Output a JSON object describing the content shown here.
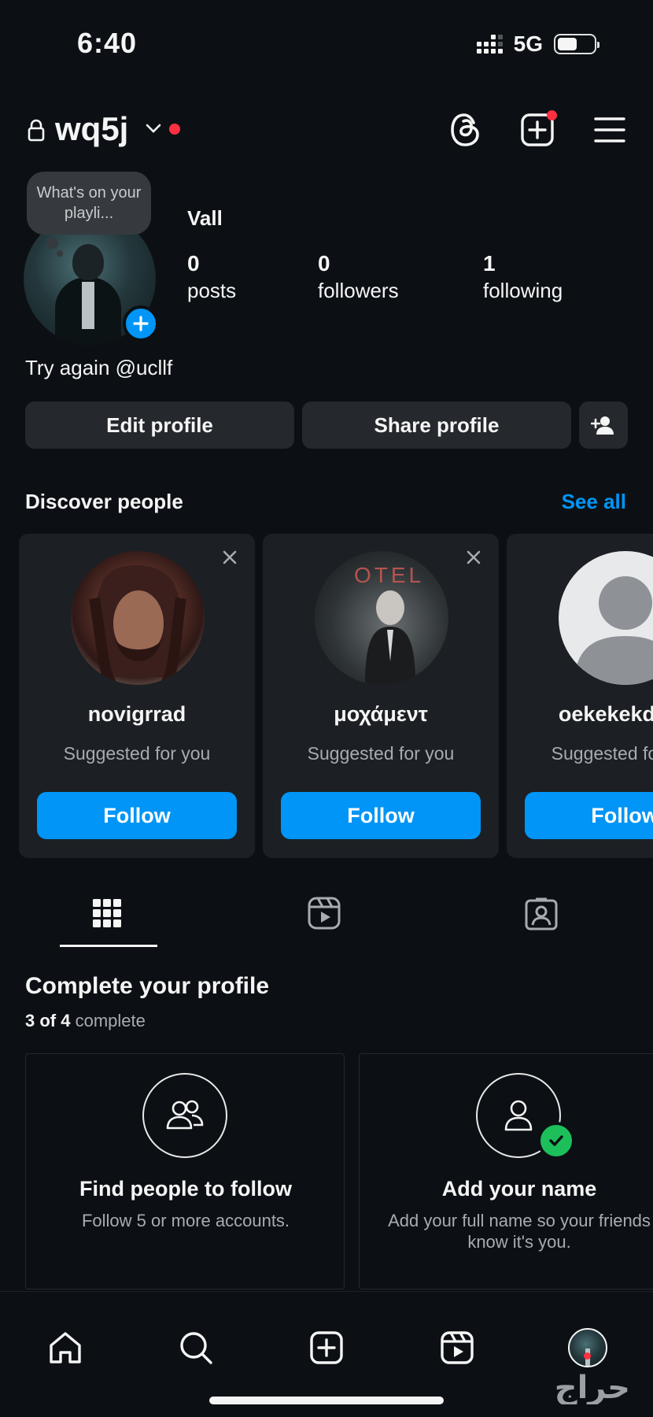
{
  "status_bar": {
    "time": "6:40",
    "network": "5G",
    "battery_level": 0.55
  },
  "header": {
    "username": "wq5j"
  },
  "profile": {
    "note": "What's on your playli...",
    "display_name": "Vall",
    "stats": [
      {
        "value": "0",
        "label": "posts"
      },
      {
        "value": "0",
        "label": "followers"
      },
      {
        "value": "1",
        "label": "following"
      }
    ],
    "bio": "Try again @ucllf",
    "edit_button": "Edit profile",
    "share_button": "Share profile"
  },
  "discover": {
    "title": "Discover people",
    "see_all": "See all",
    "cards": [
      {
        "name": "novigrrad",
        "subtitle": "Suggested for you",
        "button": "Follow"
      },
      {
        "name": "μοχάμεντ",
        "subtitle": "Suggested for you",
        "button": "Follow",
        "image_text": "OTEL"
      },
      {
        "name": "oekekekdkek",
        "subtitle": "Suggested for you",
        "button": "Follow"
      }
    ]
  },
  "complete_profile": {
    "title": "Complete your profile",
    "done": "3 of 4",
    "suffix": "complete",
    "cards": [
      {
        "heading": "Find people to follow",
        "text": "Follow 5 or more accounts."
      },
      {
        "heading": "Add your name",
        "text": "Add your full name so your friends know it's you."
      }
    ]
  },
  "watermark": "حراج",
  "icons": {
    "header": [
      "lock-icon",
      "chevron-down-icon",
      "threads-icon",
      "create-icon",
      "menu-icon"
    ],
    "tabs": [
      "grid-icon",
      "reels-icon",
      "tagged-icon"
    ],
    "nav": [
      "home-icon",
      "search-icon",
      "create-icon",
      "reels-icon",
      "profile-avatar"
    ]
  },
  "colors": {
    "accent": "#0095f6",
    "background": "#0c1014",
    "notification": "#ff3040",
    "success": "#1dbf5a"
  }
}
